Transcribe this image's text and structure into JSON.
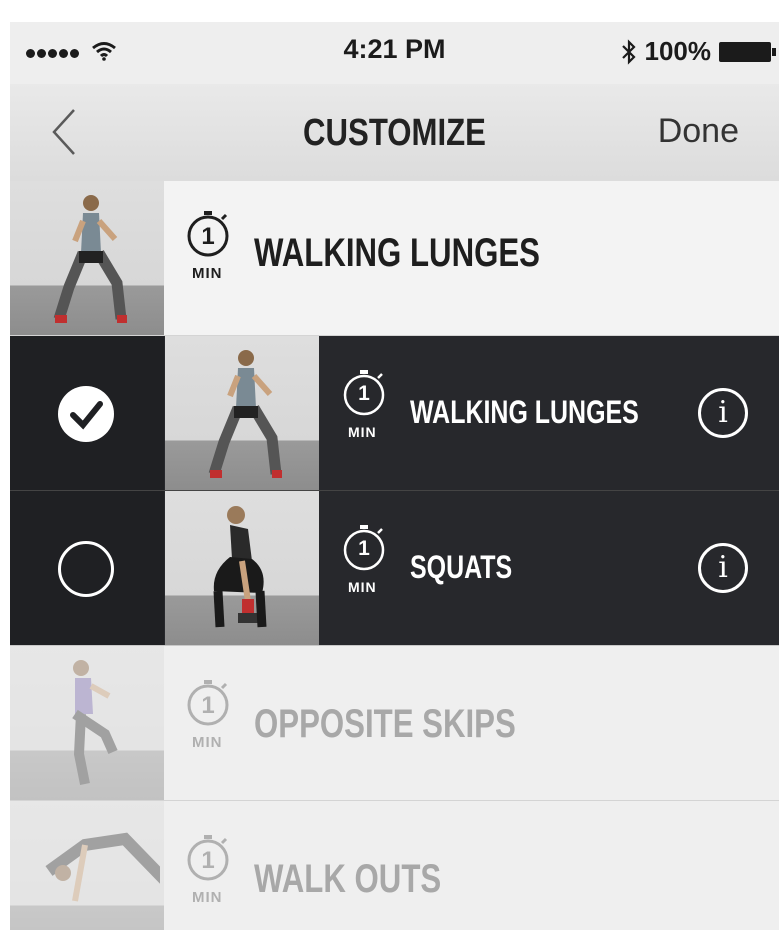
{
  "status_bar": {
    "signal_icon": "signal-dots-icon",
    "wifi_icon": "wifi-icon",
    "time": "4:21 PM",
    "bluetooth_icon": "bluetooth-icon",
    "battery": "100%",
    "battery_icon": "battery-icon"
  },
  "nav": {
    "back_icon": "chevron-left-icon",
    "title": "CUSTOMIZE",
    "done_label": "Done"
  },
  "current_exercise": {
    "duration": "1",
    "unit": "MIN",
    "name": "WALKING LUNGES"
  },
  "options": [
    {
      "selected": true,
      "duration": "1",
      "unit": "MIN",
      "name": "WALKING LUNGES",
      "info_label": "i"
    },
    {
      "selected": false,
      "duration": "1",
      "unit": "MIN",
      "name": "SQUATS",
      "info_label": "i"
    }
  ],
  "upcoming": [
    {
      "duration": "1",
      "unit": "MIN",
      "name": "OPPOSITE SKIPS"
    },
    {
      "duration": "1",
      "unit": "MIN",
      "name": "WALK OUTS"
    }
  ],
  "colors": {
    "dark_row": "#27282c",
    "accent": "#ffffff",
    "faded_text": "#a8a8a8"
  }
}
